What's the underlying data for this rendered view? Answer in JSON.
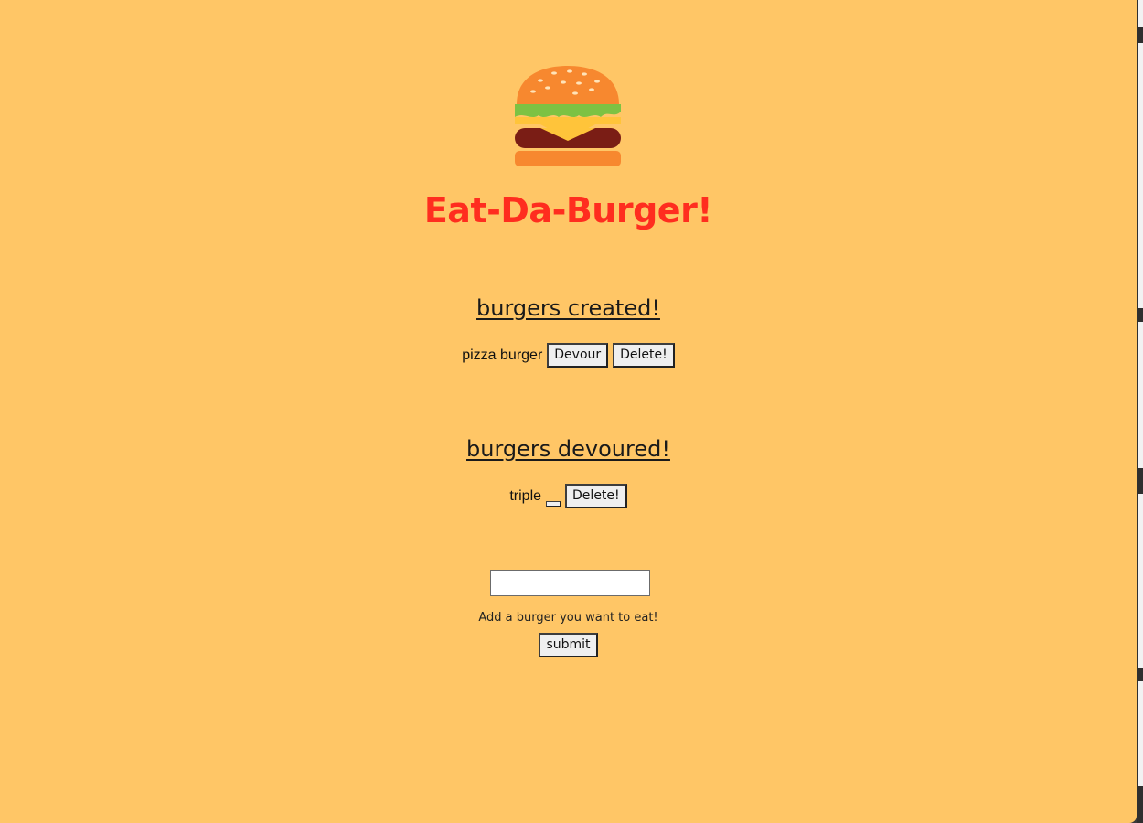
{
  "app": {
    "title": "Eat-Da-Burger!",
    "logo_icon": "burger-icon"
  },
  "created": {
    "heading": "burgers created!",
    "items": [
      {
        "name": "pizza burger",
        "devour_label": "Devour",
        "delete_label": "Delete!"
      }
    ]
  },
  "devoured": {
    "heading": "burgers devoured!",
    "items": [
      {
        "name": "triple",
        "delete_label": "Delete!"
      }
    ]
  },
  "form": {
    "input_value": "",
    "hint": "Add a burger you want to eat!",
    "submit_label": "submit"
  },
  "colors": {
    "background": "#ffc666",
    "title": "#ff2d1f"
  }
}
